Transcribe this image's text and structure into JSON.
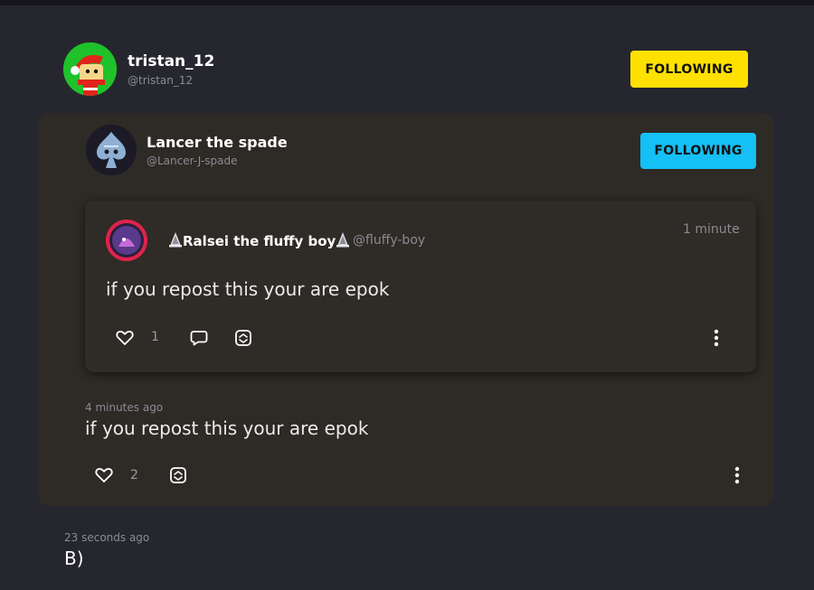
{
  "reposter": {
    "display_name": "tristan_12",
    "handle": "@tristan_12",
    "follow_label": "FOLLOWING",
    "follow_color": "#ffe100",
    "timestamp": "23 seconds ago",
    "text": "B)"
  },
  "quote": {
    "display_name": "Lancer the spade",
    "handle": "@Lancer-J-spade",
    "follow_label": "FOLLOWING",
    "follow_color": "#14c0f5",
    "timestamp": "4 minutes ago",
    "text": "if you repost this your are epok",
    "like_count": "2"
  },
  "original": {
    "display_name": "👑Ralsei the fluffy boy👑",
    "display_name_plain": "Ralsei the fluffy boy",
    "handle": "@fluffy-boy",
    "timestamp": "1 minute",
    "text": "if you repost this your are epok",
    "like_count": "1"
  },
  "icons": {
    "like": "heart-icon",
    "comment": "comment-icon",
    "repost": "repost-icon",
    "more": "more-vertical-icon",
    "crown": "crown-icon"
  },
  "colors": {
    "background": "#26262f",
    "card": "#2e2a25",
    "muted_text": "#8b8b94"
  }
}
